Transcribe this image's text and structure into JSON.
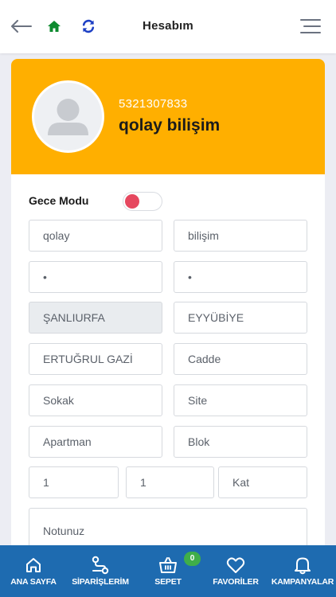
{
  "header": {
    "title": "Hesabım",
    "icons": {
      "back": "arrow-left-icon",
      "home": "home-icon",
      "refresh": "refresh-icon",
      "menu": "hamburger-menu-icon"
    },
    "colors": {
      "home": "#0d8a2e",
      "refresh": "#1c3fc4"
    }
  },
  "profile": {
    "phone": "5321307833",
    "name": "qolay bilişim",
    "header_color": "#ffaf00"
  },
  "settings": {
    "night_mode_label": "Gece Modu",
    "night_mode_on": false,
    "toggle_color": "#e6485f"
  },
  "form": {
    "first_name": "qolay",
    "last_name": "bilişim",
    "field3": "•",
    "field4": "•",
    "city": "ŞANLIURFA",
    "district": "EYYÜBİYE",
    "neighborhood": "ERTUĞRUL GAZİ",
    "street_placeholder": "Cadde",
    "alley_placeholder": "Sokak",
    "site_placeholder": "Site",
    "apartment_placeholder": "Apartman",
    "block_placeholder": "Blok",
    "num1": "1",
    "num2": "1",
    "floor_placeholder": "Kat",
    "note_placeholder": "Notunuz"
  },
  "bottom_nav": {
    "home": "ANA SAYFA",
    "orders": "SİPARİŞLERİM",
    "cart": "SEPET",
    "cart_count": "0",
    "favorites": "FAVORİLER",
    "campaigns": "KAMPANYALAR",
    "color": "#1e6bb0"
  }
}
